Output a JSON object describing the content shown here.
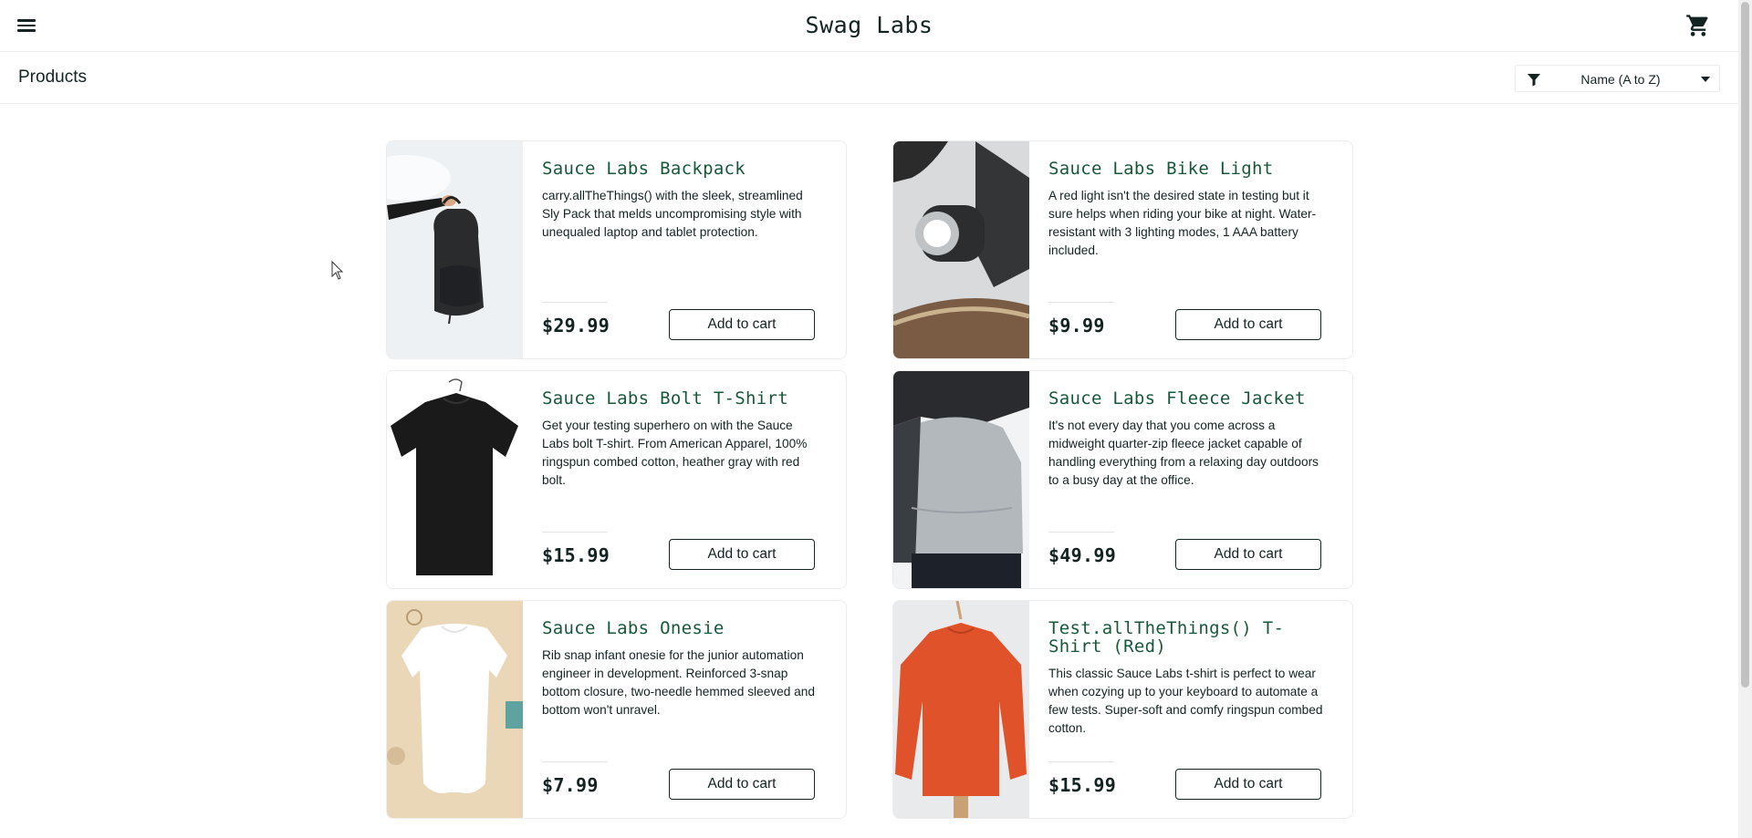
{
  "header": {
    "app_title": "Swag Labs",
    "menu_icon": "hamburger-menu-icon",
    "cart_icon": "shopping-cart-icon"
  },
  "secondary_header": {
    "title": "Products",
    "sort": {
      "selected": "Name (A to Z)",
      "icon": "filter-icon"
    }
  },
  "products": [
    {
      "name": "Sauce Labs Backpack",
      "description": "carry.allTheThings() with the sleek, streamlined Sly Pack that melds uncompromising style with unequaled laptop and tablet protection.",
      "price": "$29.99",
      "button": "Add to cart"
    },
    {
      "name": "Sauce Labs Bike Light",
      "description": "A red light isn't the desired state in testing but it sure helps when riding your bike at night. Water-resistant with 3 lighting modes, 1 AAA battery included.",
      "price": "$9.99",
      "button": "Add to cart"
    },
    {
      "name": "Sauce Labs Bolt T-Shirt",
      "description": "Get your testing superhero on with the Sauce Labs bolt T-shirt. From American Apparel, 100% ringspun combed cotton, heather gray with red bolt.",
      "price": "$15.99",
      "button": "Add to cart"
    },
    {
      "name": "Sauce Labs Fleece Jacket",
      "description": "It's not every day that you come across a midweight quarter-zip fleece jacket capable of handling everything from a relaxing day outdoors to a busy day at the office.",
      "price": "$49.99",
      "button": "Add to cart"
    },
    {
      "name": "Sauce Labs Onesie",
      "description": "Rib snap infant onesie for the junior automation engineer in development. Reinforced 3-snap bottom closure, two-needle hemmed sleeved and bottom won't unravel.",
      "price": "$7.99",
      "button": "Add to cart"
    },
    {
      "name": "Test.allTheThings() T-Shirt (Red)",
      "description": "This classic Sauce Labs t-shirt is perfect to wear when cozying up to your keyboard to automate a few tests. Super-soft and comfy ringspun combed cotton.",
      "price": "$15.99",
      "button": "Add to cart"
    }
  ],
  "colors": {
    "title_green": "#18583a",
    "text_dark": "#132322",
    "border": "#ededed"
  }
}
